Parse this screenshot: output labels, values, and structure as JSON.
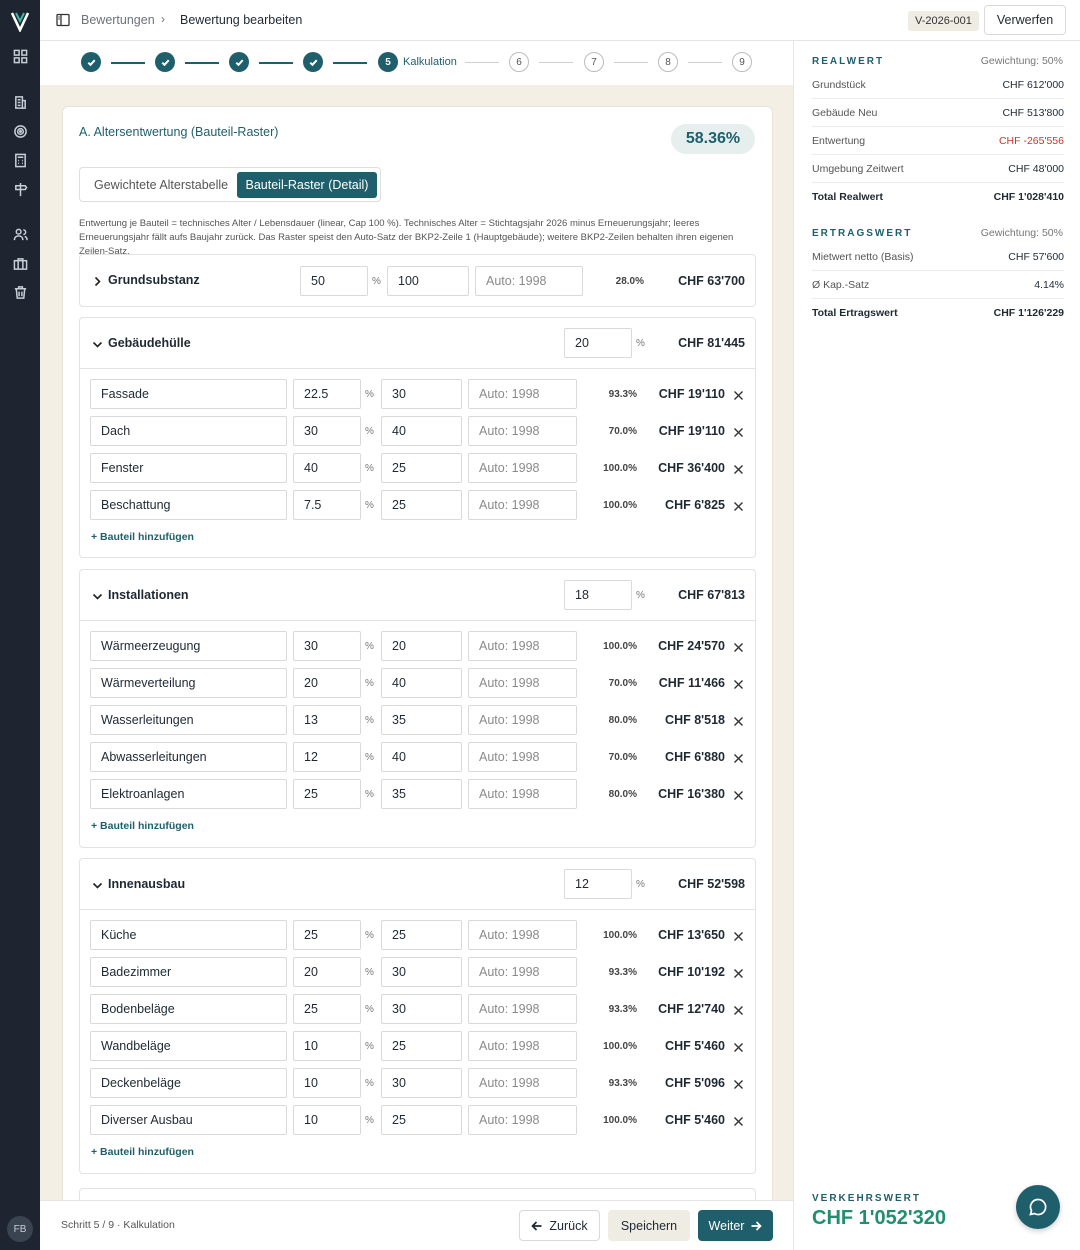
{
  "topbar": {
    "breadcrumb_parent": "Bewertungen",
    "breadcrumb_current": "Bewertung bearbeiten",
    "version_badge": "V-2026-001",
    "discard_label": "Verwerfen"
  },
  "sidebar": {
    "avatar_initials": "FB",
    "icons": [
      "dashboard-icon",
      "building-icon",
      "target-icon",
      "calculator-icon",
      "signpost-icon",
      "users-icon",
      "briefcase-icon",
      "trash-icon"
    ]
  },
  "stepper": {
    "current_number": "5",
    "current_label": "Kalkulation",
    "upcoming": [
      "6",
      "7",
      "8",
      "9"
    ]
  },
  "section": {
    "title": "A. Altersentwertung (Bauteil-Raster)",
    "percentage": "58.36%",
    "tab_table": "Gewichtete Alterstabelle",
    "tab_grid": "Bauteil-Raster (Detail)",
    "description": "Entwertung je Bauteil = technisches Alter / Lebensdauer (linear, Cap 100 %). Technisches Alter = Stichtagsjahr 2026 minus Erneuerungsjahr; leeres Erneuerungsjahr fällt aufs Baujahr zurück. Das Raster speist den Auto-Satz der BKP2-Zeile 1 (Hauptgebäude); weitere BKP2-Zeilen behalten ihren eigenen Zeilen-Satz."
  },
  "grundsubstanz": {
    "name": "Grundsubstanz",
    "weight": "50",
    "lifetime": "100",
    "year_placeholder": "Auto: 1998",
    "share": "28.0%",
    "amount": "CHF 63'700"
  },
  "groups": [
    {
      "name": "Gebäudehülle",
      "weight": "20",
      "amount": "CHF 81'445",
      "items": [
        {
          "name": "Fassade",
          "weight": "22.5",
          "lifetime": "30",
          "year_placeholder": "Auto: 1998",
          "share": "93.3%",
          "amount": "CHF 19'110"
        },
        {
          "name": "Dach",
          "weight": "30",
          "lifetime": "40",
          "year_placeholder": "Auto: 1998",
          "share": "70.0%",
          "amount": "CHF 19'110"
        },
        {
          "name": "Fenster",
          "weight": "40",
          "lifetime": "25",
          "year_placeholder": "Auto: 1998",
          "share": "100.0%",
          "amount": "CHF 36'400"
        },
        {
          "name": "Beschattung",
          "weight": "7.5",
          "lifetime": "25",
          "year_placeholder": "Auto: 1998",
          "share": "100.0%",
          "amount": "CHF 6'825"
        }
      ],
      "add_label": "+ Bauteil hinzufügen"
    },
    {
      "name": "Installationen",
      "weight": "18",
      "amount": "CHF 67'813",
      "items": [
        {
          "name": "Wärmeerzeugung",
          "weight": "30",
          "lifetime": "20",
          "year_placeholder": "Auto: 1998",
          "share": "100.0%",
          "amount": "CHF 24'570"
        },
        {
          "name": "Wärmeverteilung",
          "weight": "20",
          "lifetime": "40",
          "year_placeholder": "Auto: 1998",
          "share": "70.0%",
          "amount": "CHF 11'466"
        },
        {
          "name": "Wasserleitungen",
          "weight": "13",
          "lifetime": "35",
          "year_placeholder": "Auto: 1998",
          "share": "80.0%",
          "amount": "CHF 8'518"
        },
        {
          "name": "Abwasserleitungen",
          "weight": "12",
          "lifetime": "40",
          "year_placeholder": "Auto: 1998",
          "share": "70.0%",
          "amount": "CHF 6'880"
        },
        {
          "name": "Elektroanlagen",
          "weight": "25",
          "lifetime": "35",
          "year_placeholder": "Auto: 1998",
          "share": "80.0%",
          "amount": "CHF 16'380"
        }
      ],
      "add_label": "+ Bauteil hinzufügen"
    },
    {
      "name": "Innenausbau",
      "weight": "12",
      "amount": "CHF 52'598",
      "items": [
        {
          "name": "Küche",
          "weight": "25",
          "lifetime": "25",
          "year_placeholder": "Auto: 1998",
          "share": "100.0%",
          "amount": "CHF 13'650"
        },
        {
          "name": "Badezimmer",
          "weight": "20",
          "lifetime": "30",
          "year_placeholder": "Auto: 1998",
          "share": "93.3%",
          "amount": "CHF 10'192"
        },
        {
          "name": "Bodenbeläge",
          "weight": "25",
          "lifetime": "30",
          "year_placeholder": "Auto: 1998",
          "share": "93.3%",
          "amount": "CHF 12'740"
        },
        {
          "name": "Wandbeläge",
          "weight": "10",
          "lifetime": "25",
          "year_placeholder": "Auto: 1998",
          "share": "100.0%",
          "amount": "CHF 5'460"
        },
        {
          "name": "Deckenbeläge",
          "weight": "10",
          "lifetime": "30",
          "year_placeholder": "Auto: 1998",
          "share": "93.3%",
          "amount": "CHF 5'096"
        },
        {
          "name": "Diverser Ausbau",
          "weight": "10",
          "lifetime": "25",
          "year_placeholder": "Auto: 1998",
          "share": "100.0%",
          "amount": "CHF 5'460"
        }
      ],
      "add_label": "+ Bauteil hinzufügen"
    }
  ],
  "percent_sign": "%",
  "right_panel": {
    "realwert": {
      "title": "REALWERT",
      "weighting": "Gewichtung: 50%",
      "rows": [
        {
          "label": "Grundstück",
          "value": "CHF 612'000"
        },
        {
          "label": "Gebäude Neu",
          "value": "CHF 513'800"
        },
        {
          "label": "Entwertung",
          "value": "CHF -265'556"
        },
        {
          "label": "Umgebung Zeitwert",
          "value": "CHF 48'000"
        },
        {
          "label": "Total Realwert",
          "value": "CHF 1'028'410"
        }
      ]
    },
    "ertragswert": {
      "title": "ERTRAGSWERT",
      "weighting": "Gewichtung: 50%",
      "rows": [
        {
          "label": "Mietwert netto (Basis)",
          "value": "CHF 57'600"
        },
        {
          "label": "Ø Kap.-Satz",
          "value": "4.14%"
        },
        {
          "label": "Total Ertragswert",
          "value": "CHF 1'126'229"
        }
      ]
    },
    "verkehrswert_label": "VERKEHRSWERT",
    "verkehrswert_value": "CHF 1'052'320",
    "colors": {
      "accent": "#1f5f6b",
      "negative": "#c0392b",
      "result": "#1f8f6f"
    }
  },
  "footer": {
    "step_text": "Schritt 5 / 9 · Kalkulation",
    "back_label": "Zurück",
    "save_label": "Speichern",
    "next_label": "Weiter"
  }
}
